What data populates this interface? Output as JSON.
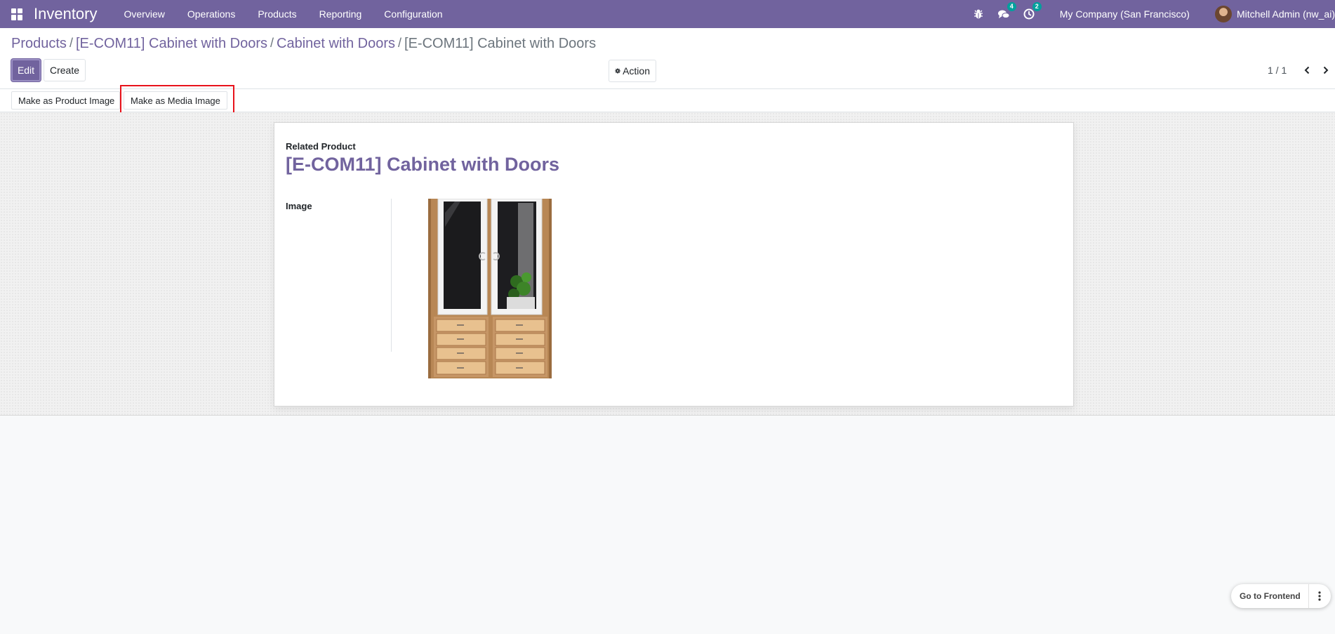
{
  "navbar": {
    "app_name": "Inventory",
    "menu": [
      "Overview",
      "Operations",
      "Products",
      "Reporting",
      "Configuration"
    ],
    "messages_count": "4",
    "activities_count": "2",
    "company": "My Company (San Francisco)",
    "user": "Mitchell Admin (nw_ai)"
  },
  "breadcrumb": {
    "items": [
      "Products",
      "[E-COM11] Cabinet with Doors",
      "Cabinet with Doors"
    ],
    "current": "[E-COM11] Cabinet with Doors",
    "separator": "/"
  },
  "buttons": {
    "edit": "Edit",
    "create": "Create",
    "action": "Action"
  },
  "pager": {
    "value": "1 / 1"
  },
  "status_bar": {
    "make_product_image": "Make as Product Image",
    "make_media_image": "Make as Media Image"
  },
  "form": {
    "related_product_label": "Related Product",
    "product_name": "[E-COM11] Cabinet with Doors",
    "image_label": "Image"
  },
  "footer": {
    "go_to_frontend": "Go to Frontend"
  },
  "colors": {
    "brand": "#71639e",
    "highlight": "#e8131b",
    "badge": "#00a09d"
  },
  "icons": {
    "apps": "apps-grid-icon",
    "debug": "bug-icon",
    "messages": "chat-bubbles-icon",
    "activities": "clock-icon",
    "action": "gear-icon",
    "prev": "chevron-left-icon",
    "next": "chevron-right-icon",
    "more": "vertical-dots-icon"
  }
}
